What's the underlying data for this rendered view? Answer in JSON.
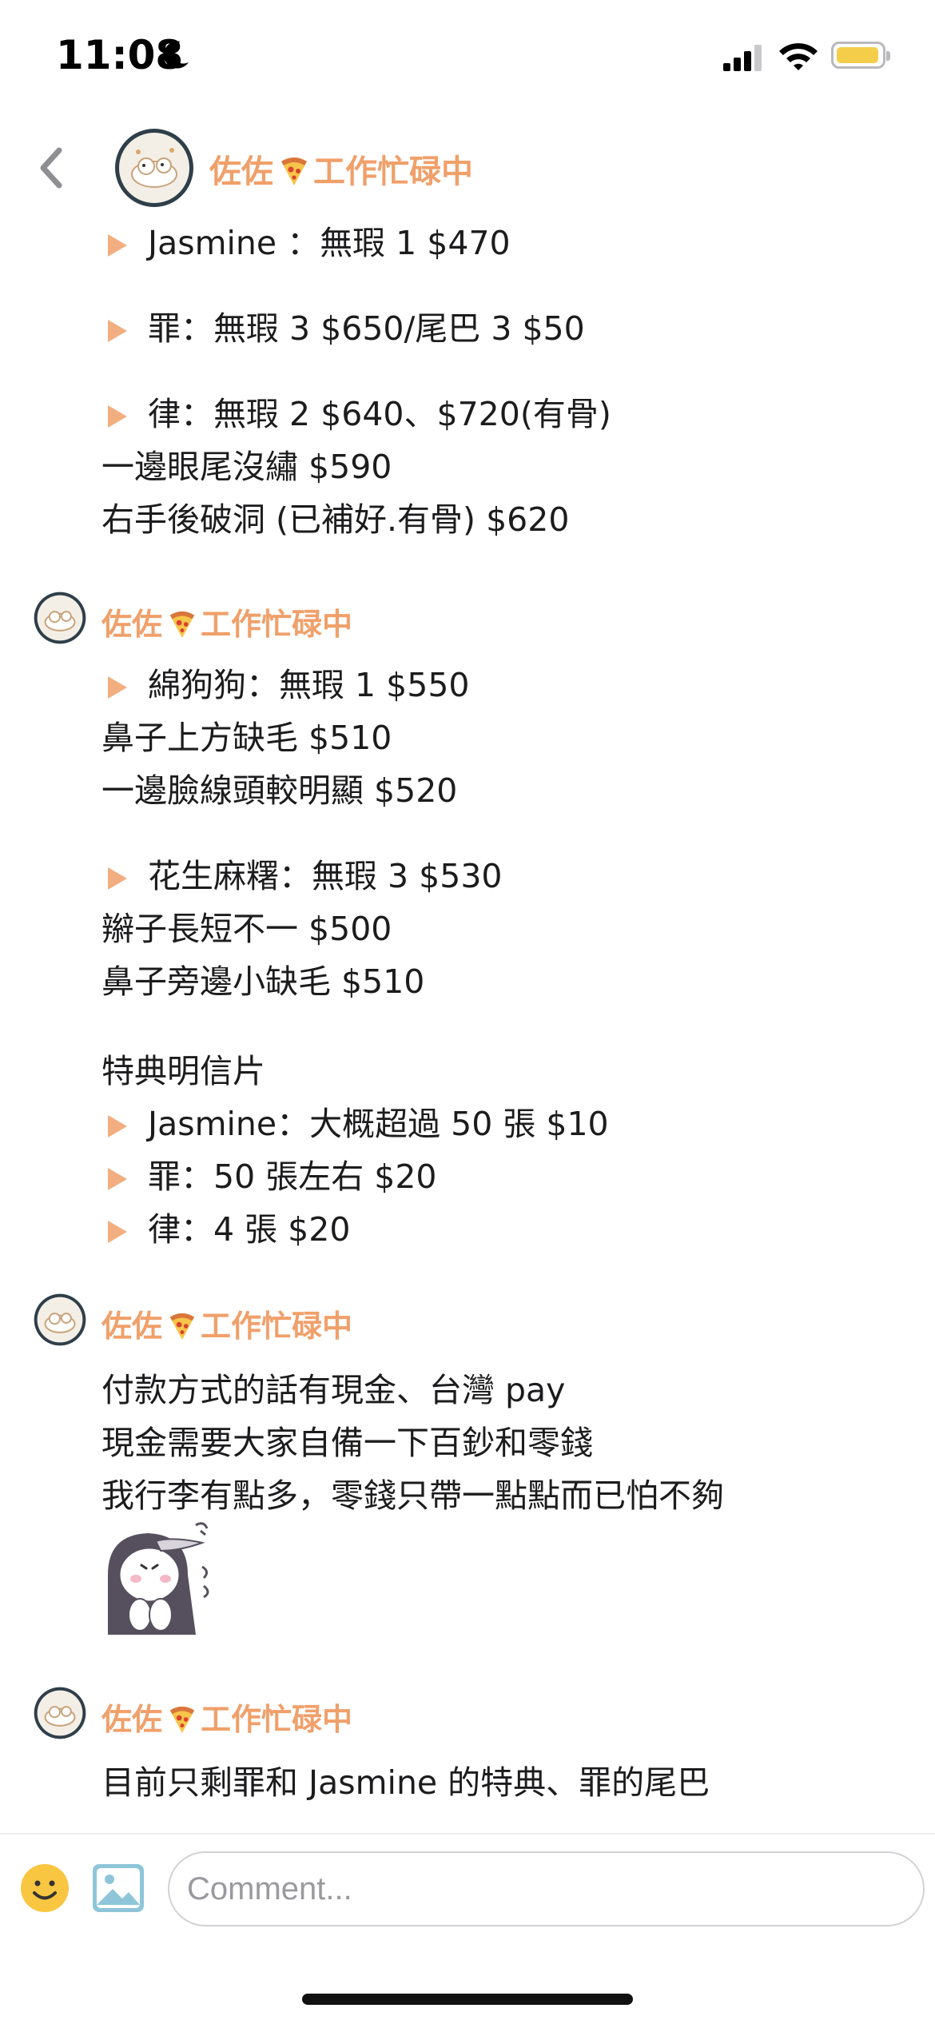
{
  "status_bar": {
    "time": "11:08",
    "icons": [
      "moon-icon",
      "signal-icon",
      "wifi-icon",
      "battery-icon"
    ],
    "battery_color": "#f4cd4b"
  },
  "header": {
    "name": "佐佐",
    "status": "工作忙碌中",
    "icons": [
      "back-chevron-icon",
      "pizza-icon"
    ]
  },
  "theme": {
    "accent": "#f0a06a",
    "text": "#1c1c1e"
  },
  "messages": [
    {
      "lines": [
        "Jasmine ：無瑕 1 $470",
        "罪：無瑕 3 $650/尾巴 3 $50",
        "律：無瑕 2 $640、$720(有骨)",
        "一邊眼尾沒繡 $590",
        "右手後破洞 (已補好.有骨) $620"
      ]
    },
    {
      "author": "佐佐",
      "status": "工作忙碌中",
      "lines": [
        "綿狗狗：無瑕 1 $550",
        "鼻子上方缺毛 $510",
        "一邊臉線頭較明顯 $520",
        "花生麻糬：無瑕 3 $530",
        "辮子長短不一 $500",
        "鼻子旁邊小缺毛 $510",
        "特典明信片",
        "Jasmine：大概超過 50 張 $10",
        "罪：50 張左右 $20",
        "律：4 張 $20"
      ]
    },
    {
      "author": "佐佐",
      "status": "工作忙碌中",
      "lines": [
        "付款方式的話有現金、台灣 pay",
        "現金需要大家自備一下百鈔和零錢",
        "我行李有點多，零錢只帶一點點而已怕不夠"
      ],
      "sticker": "penguin-sticker"
    },
    {
      "author": "佐佐",
      "status": "工作忙碌中",
      "lines": [
        "目前只剩罪和 Jasmine 的特典、罪的尾巴"
      ]
    }
  ],
  "composer": {
    "placeholder": "Comment...",
    "icons": [
      "emoji-icon",
      "image-icon"
    ]
  }
}
